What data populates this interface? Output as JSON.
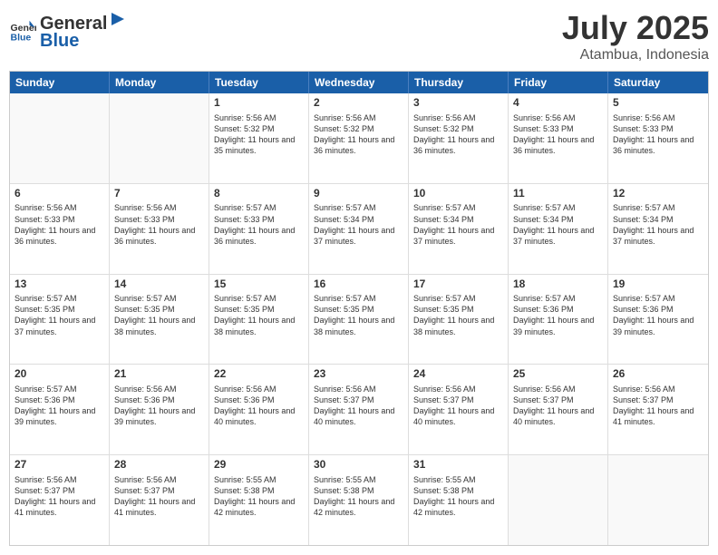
{
  "header": {
    "logo_general": "General",
    "logo_blue": "Blue",
    "month": "July 2025",
    "location": "Atambua, Indonesia"
  },
  "days_of_week": [
    "Sunday",
    "Monday",
    "Tuesday",
    "Wednesday",
    "Thursday",
    "Friday",
    "Saturday"
  ],
  "weeks": [
    [
      {
        "day": "",
        "empty": true
      },
      {
        "day": "",
        "empty": true
      },
      {
        "day": "1",
        "sunrise": "5:56 AM",
        "sunset": "5:32 PM",
        "daylight": "11 hours and 35 minutes."
      },
      {
        "day": "2",
        "sunrise": "5:56 AM",
        "sunset": "5:32 PM",
        "daylight": "11 hours and 36 minutes."
      },
      {
        "day": "3",
        "sunrise": "5:56 AM",
        "sunset": "5:32 PM",
        "daylight": "11 hours and 36 minutes."
      },
      {
        "day": "4",
        "sunrise": "5:56 AM",
        "sunset": "5:33 PM",
        "daylight": "11 hours and 36 minutes."
      },
      {
        "day": "5",
        "sunrise": "5:56 AM",
        "sunset": "5:33 PM",
        "daylight": "11 hours and 36 minutes."
      }
    ],
    [
      {
        "day": "6",
        "sunrise": "5:56 AM",
        "sunset": "5:33 PM",
        "daylight": "11 hours and 36 minutes."
      },
      {
        "day": "7",
        "sunrise": "5:56 AM",
        "sunset": "5:33 PM",
        "daylight": "11 hours and 36 minutes."
      },
      {
        "day": "8",
        "sunrise": "5:57 AM",
        "sunset": "5:33 PM",
        "daylight": "11 hours and 36 minutes."
      },
      {
        "day": "9",
        "sunrise": "5:57 AM",
        "sunset": "5:34 PM",
        "daylight": "11 hours and 37 minutes."
      },
      {
        "day": "10",
        "sunrise": "5:57 AM",
        "sunset": "5:34 PM",
        "daylight": "11 hours and 37 minutes."
      },
      {
        "day": "11",
        "sunrise": "5:57 AM",
        "sunset": "5:34 PM",
        "daylight": "11 hours and 37 minutes."
      },
      {
        "day": "12",
        "sunrise": "5:57 AM",
        "sunset": "5:34 PM",
        "daylight": "11 hours and 37 minutes."
      }
    ],
    [
      {
        "day": "13",
        "sunrise": "5:57 AM",
        "sunset": "5:35 PM",
        "daylight": "11 hours and 37 minutes."
      },
      {
        "day": "14",
        "sunrise": "5:57 AM",
        "sunset": "5:35 PM",
        "daylight": "11 hours and 38 minutes."
      },
      {
        "day": "15",
        "sunrise": "5:57 AM",
        "sunset": "5:35 PM",
        "daylight": "11 hours and 38 minutes."
      },
      {
        "day": "16",
        "sunrise": "5:57 AM",
        "sunset": "5:35 PM",
        "daylight": "11 hours and 38 minutes."
      },
      {
        "day": "17",
        "sunrise": "5:57 AM",
        "sunset": "5:35 PM",
        "daylight": "11 hours and 38 minutes."
      },
      {
        "day": "18",
        "sunrise": "5:57 AM",
        "sunset": "5:36 PM",
        "daylight": "11 hours and 39 minutes."
      },
      {
        "day": "19",
        "sunrise": "5:57 AM",
        "sunset": "5:36 PM",
        "daylight": "11 hours and 39 minutes."
      }
    ],
    [
      {
        "day": "20",
        "sunrise": "5:57 AM",
        "sunset": "5:36 PM",
        "daylight": "11 hours and 39 minutes."
      },
      {
        "day": "21",
        "sunrise": "5:56 AM",
        "sunset": "5:36 PM",
        "daylight": "11 hours and 39 minutes."
      },
      {
        "day": "22",
        "sunrise": "5:56 AM",
        "sunset": "5:36 PM",
        "daylight": "11 hours and 40 minutes."
      },
      {
        "day": "23",
        "sunrise": "5:56 AM",
        "sunset": "5:37 PM",
        "daylight": "11 hours and 40 minutes."
      },
      {
        "day": "24",
        "sunrise": "5:56 AM",
        "sunset": "5:37 PM",
        "daylight": "11 hours and 40 minutes."
      },
      {
        "day": "25",
        "sunrise": "5:56 AM",
        "sunset": "5:37 PM",
        "daylight": "11 hours and 40 minutes."
      },
      {
        "day": "26",
        "sunrise": "5:56 AM",
        "sunset": "5:37 PM",
        "daylight": "11 hours and 41 minutes."
      }
    ],
    [
      {
        "day": "27",
        "sunrise": "5:56 AM",
        "sunset": "5:37 PM",
        "daylight": "11 hours and 41 minutes."
      },
      {
        "day": "28",
        "sunrise": "5:56 AM",
        "sunset": "5:37 PM",
        "daylight": "11 hours and 41 minutes."
      },
      {
        "day": "29",
        "sunrise": "5:55 AM",
        "sunset": "5:38 PM",
        "daylight": "11 hours and 42 minutes."
      },
      {
        "day": "30",
        "sunrise": "5:55 AM",
        "sunset": "5:38 PM",
        "daylight": "11 hours and 42 minutes."
      },
      {
        "day": "31",
        "sunrise": "5:55 AM",
        "sunset": "5:38 PM",
        "daylight": "11 hours and 42 minutes."
      },
      {
        "day": "",
        "empty": true
      },
      {
        "day": "",
        "empty": true
      }
    ]
  ]
}
